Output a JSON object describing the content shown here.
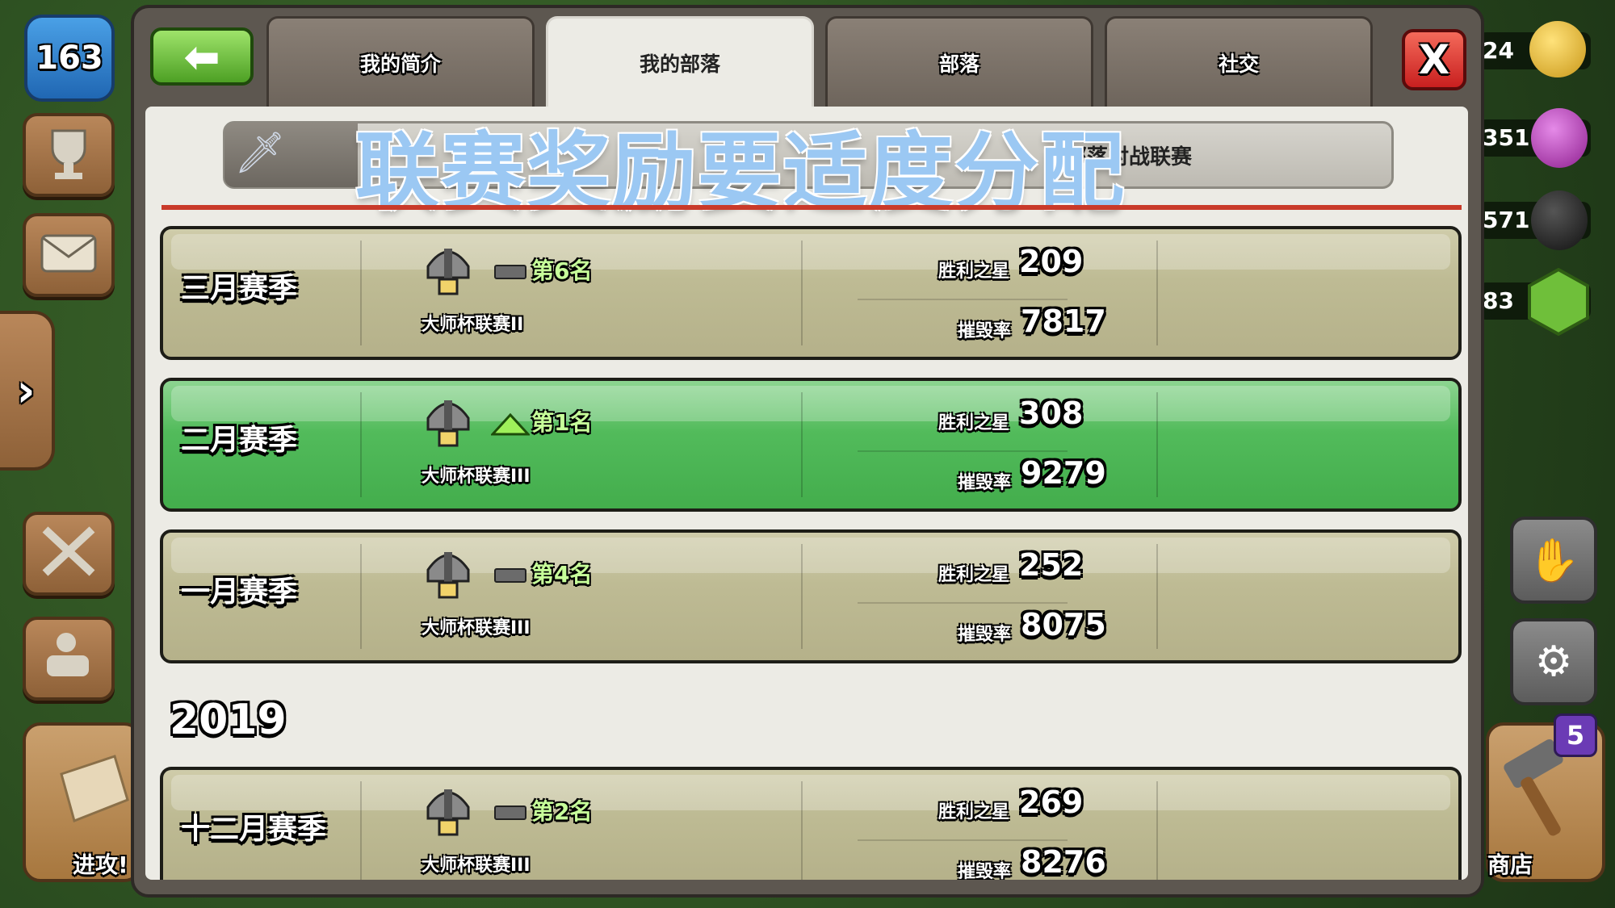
{
  "hud_left": {
    "level": "163",
    "attack_label": "进攻!"
  },
  "hud_right": {
    "resources": [
      "24",
      "351",
      "571",
      "83"
    ],
    "shop_label": "商店",
    "shop_badge": "5"
  },
  "tabs": [
    {
      "label": "我的简介",
      "active": false
    },
    {
      "label": "我的部落",
      "active": true
    },
    {
      "label": "部落",
      "active": false
    },
    {
      "label": "社交",
      "active": false
    }
  ],
  "subbar": {
    "left_text": "",
    "right_text": "部落对战联赛"
  },
  "overlay_title": "联赛奖励要适度分配",
  "seasons": [
    {
      "name": "三月赛季",
      "trend": "same",
      "rank": "第6名",
      "league": "大师杯联赛II",
      "stars_label": "胜利之星",
      "stars": "209",
      "destruction_label": "摧毁率",
      "destruction": "7817",
      "highlight": false
    },
    {
      "name": "二月赛季",
      "trend": "up",
      "rank": "第1名",
      "league": "大师杯联赛III",
      "stars_label": "胜利之星",
      "stars": "308",
      "destruction_label": "摧毁率",
      "destruction": "9279",
      "highlight": true
    },
    {
      "name": "一月赛季",
      "trend": "same",
      "rank": "第4名",
      "league": "大师杯联赛III",
      "stars_label": "胜利之星",
      "stars": "252",
      "destruction_label": "摧毁率",
      "destruction": "8075",
      "highlight": false
    }
  ],
  "year_2019": {
    "label": "2019",
    "seasons": [
      {
        "name": "十二月赛季",
        "trend": "same",
        "rank": "第2名",
        "league": "大师杯联赛III",
        "stars_label": "胜利之星",
        "stars": "269",
        "destruction_label": "摧毁率",
        "destruction": "8276",
        "highlight": false
      }
    ]
  },
  "colors": {
    "highlight_green": "#52bb5b",
    "card_olive": "#bebb94",
    "back_green": "#4da024",
    "close_red": "#c81f1f",
    "rank_green": "#c7ff9a"
  }
}
